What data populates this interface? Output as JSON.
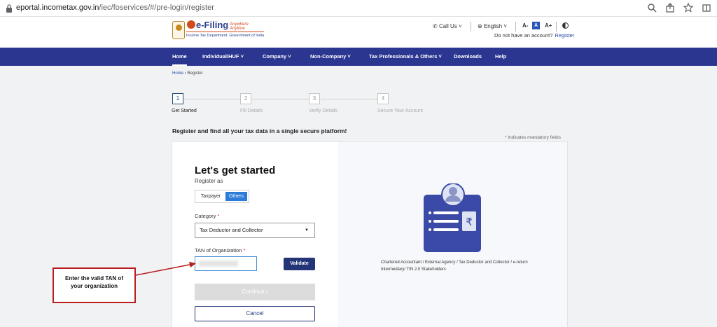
{
  "browser": {
    "url_domain": "eportal.incometax.gov.in",
    "url_path": "/iec/foservices/#/pre-login/register"
  },
  "header": {
    "logo_brand": "e-Filing",
    "logo_tagline": "Anywhere Anytime",
    "logo_department": "Income Tax Department, Government of India",
    "call_us": "Call Us",
    "language": "English",
    "font_decrease": "A-",
    "font_default": "A",
    "font_increase": "A+",
    "no_account_text": "Do not have an account?",
    "register_link": "Register"
  },
  "nav": {
    "items": [
      {
        "label": "Home"
      },
      {
        "label": "Individual/HUF ˅"
      },
      {
        "label": "Company ˅"
      },
      {
        "label": "Non-Company ˅"
      },
      {
        "label": "Tax Professionals & Others ˅"
      },
      {
        "label": "Downloads"
      },
      {
        "label": "Help"
      }
    ]
  },
  "breadcrumb": {
    "home": "Home",
    "current": "Register"
  },
  "stepper": {
    "steps": [
      {
        "number": "1",
        "label": "Get Started"
      },
      {
        "number": "2",
        "label": "Fill Details"
      },
      {
        "number": "3",
        "label": "Verify Details"
      },
      {
        "number": "4",
        "label": "Secure Your Account"
      }
    ]
  },
  "page": {
    "tagline": "Register and find all your tax data in a single secure platform!",
    "mandatory_note": "* Indicates mandatory fields"
  },
  "form": {
    "heading": "Let's get started",
    "register_as_label": "Register as",
    "toggle_taxpayer": "Taxpayer",
    "toggle_others": "Others",
    "category_label": "Category",
    "category_value": "Tax  Deductor and Collector",
    "tan_label": "TAN of Organization",
    "required_mark": "*",
    "validate_label": "Validate",
    "continue_label": "Continue  ›",
    "cancel_label": "Cancel"
  },
  "illustration": {
    "rupee_symbol": "₹",
    "roles_text": "Chartered Accountant / External Agency / Tax Deductor and Collector / e-return Intermediary/ TIN 2.0 Stakeholders"
  },
  "callout": {
    "text_line1": "Enter the valid TAN of",
    "text_line2": "your organization"
  },
  "colors": {
    "nav_bg": "#2b3690",
    "primary_button": "#233477",
    "toggle_active": "#2b7bd8",
    "callout_border": "#b91d1d"
  }
}
